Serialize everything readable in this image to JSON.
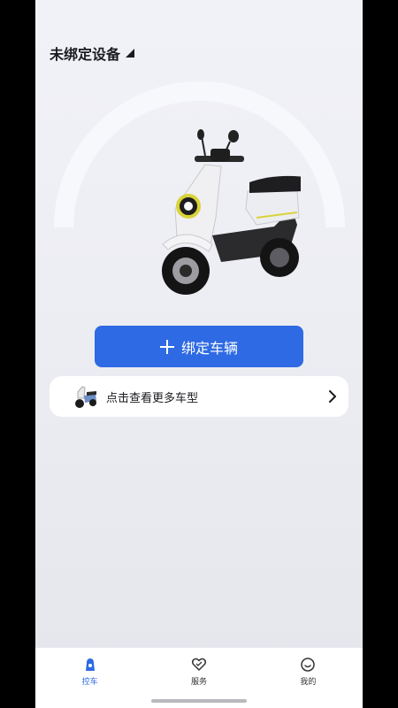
{
  "header": {
    "title": "未绑定设备",
    "dropdown_icon": "triangle-dropdown-icon"
  },
  "hero": {
    "image": "scooter-image"
  },
  "bind_button": {
    "icon": "plus-icon",
    "label": "绑定车辆"
  },
  "more_models": {
    "icon": "scooter-thumbnail",
    "label": "点击查看更多车型",
    "chevron": "chevron-right-icon"
  },
  "tabbar": {
    "active_color": "#2e6ae3",
    "tabs": [
      {
        "label": "控车",
        "icon": "scooter-control-icon",
        "active": true
      },
      {
        "label": "服务",
        "icon": "service-heart-icon",
        "active": false
      },
      {
        "label": "我的",
        "icon": "profile-smile-icon",
        "active": false
      }
    ]
  }
}
